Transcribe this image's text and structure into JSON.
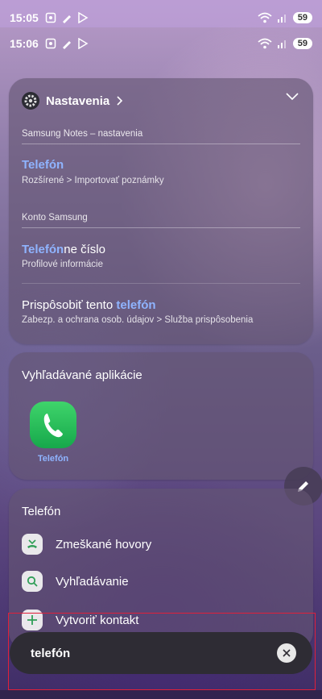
{
  "status_bar_1": {
    "time": "15:05",
    "battery": "59"
  },
  "status_bar_2": {
    "time": "15:06",
    "battery": "59"
  },
  "settings_card": {
    "title": "Nastavenia",
    "sections": [
      {
        "title": "Samsung Notes – nastavenia",
        "items": [
          {
            "highlight": "Telefón",
            "rest": "",
            "subtitle": "Rozšírené > Importovať poznámky"
          }
        ]
      },
      {
        "title": "Konto Samsung",
        "items": [
          {
            "highlight": "Telefón",
            "rest": "ne číslo",
            "subtitle": "Profilové informácie"
          },
          {
            "prefix": "Prispôsobiť tento ",
            "highlight": "telefón",
            "subtitle": "Zabezp. a ochrana osob. údajov > Služba prispôsobenia"
          }
        ]
      }
    ]
  },
  "apps_card": {
    "title": "Vyhľadávané aplikácie",
    "app_label": "Telefón",
    "accent": "#2fbf5a"
  },
  "phone_card": {
    "title": "Telefón",
    "actions": [
      {
        "label": "Zmeškané hovory",
        "icon": "missed-call-icon"
      },
      {
        "label": "Vyhľadávanie",
        "icon": "search-icon"
      },
      {
        "label": "Vytvoriť kontakt",
        "icon": "plus-icon"
      }
    ]
  },
  "search": {
    "query": "telefón"
  }
}
